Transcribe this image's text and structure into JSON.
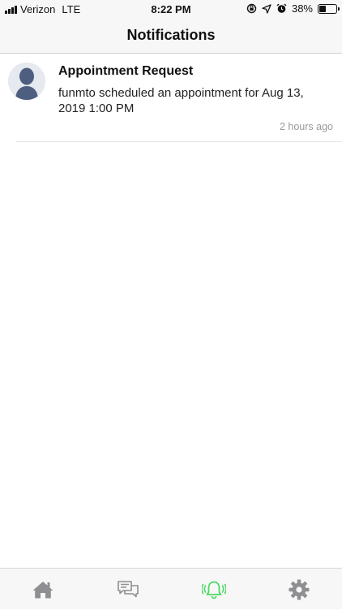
{
  "status_bar": {
    "carrier": "Verizon",
    "network": "LTE",
    "time": "8:22 PM",
    "battery_percent": "38%",
    "battery_level": 0.38,
    "icons": [
      "signal-bars-icon",
      "screen-rotation-lock-icon",
      "location-arrow-icon",
      "alarm-clock-icon",
      "battery-icon"
    ]
  },
  "nav": {
    "title": "Notifications"
  },
  "notifications": [
    {
      "title": "Appointment Request",
      "body": "funmto scheduled an appointment for Aug 13, 2019 1:00 PM",
      "time": "2 hours ago",
      "avatar_icon": "default-user-avatar-icon"
    }
  ],
  "tab_bar": {
    "tabs": [
      {
        "name": "home",
        "icon": "home-icon",
        "active": false
      },
      {
        "name": "messages",
        "icon": "chat-bubbles-icon",
        "active": false
      },
      {
        "name": "notifications",
        "icon": "bell-ringing-icon",
        "active": true
      },
      {
        "name": "settings",
        "icon": "gear-icon",
        "active": false
      }
    ],
    "active_color": "#4cd964",
    "inactive_color": "#8e8e93"
  }
}
